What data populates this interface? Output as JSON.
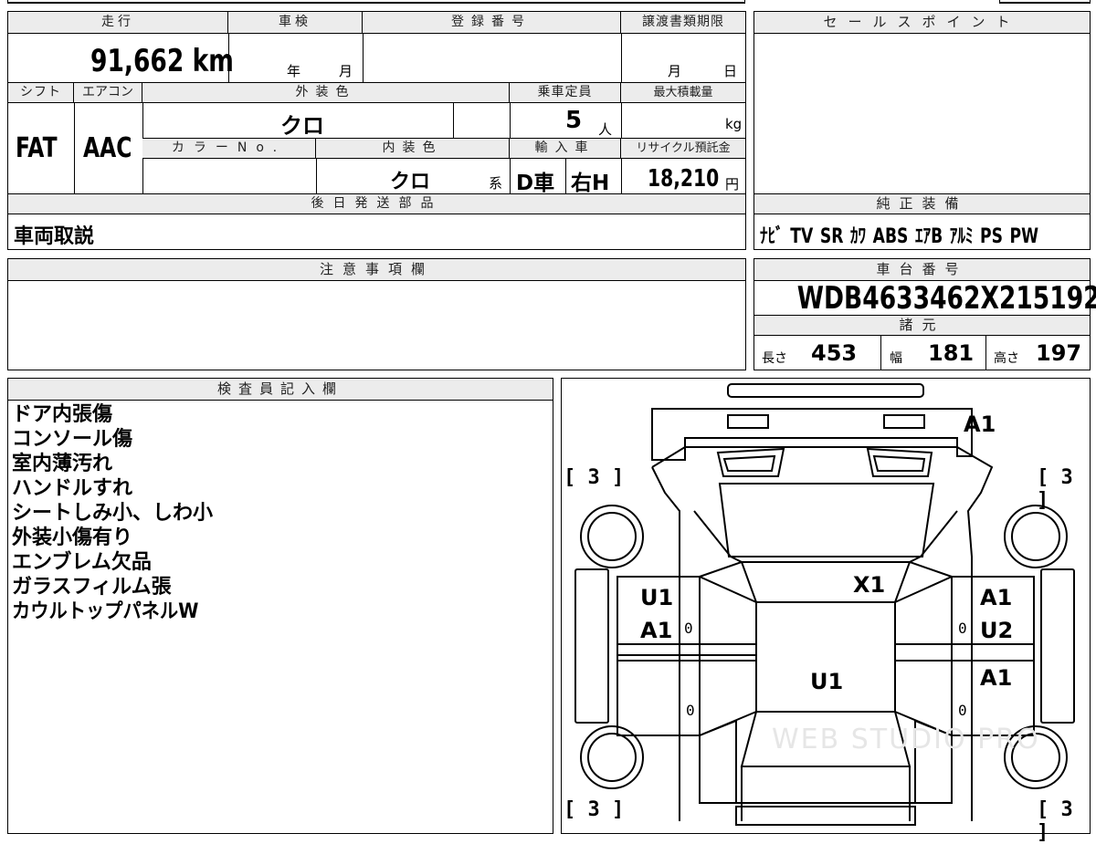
{
  "vehicle": {
    "mileage_label": "走行",
    "mileage_value": "91,662 km",
    "inspection_label": "車検",
    "inspection_year_unit": "年",
    "inspection_month_unit": "月",
    "registration_label": "登録番号",
    "transfer_deadline_label": "譲渡書類期限",
    "transfer_month_unit": "月",
    "transfer_day_unit": "日",
    "shift_label": "シフト",
    "shift_value": "FAT",
    "aircon_label": "エアコン",
    "aircon_value": "AAC",
    "exterior_color_label": "外装色",
    "exterior_color_value": "クロ",
    "capacity_label": "乗車定員",
    "capacity_value": "5",
    "capacity_unit": "人",
    "max_load_label": "最大積載量",
    "max_load_unit": "kg",
    "color_no_label": "カラーNo.",
    "interior_color_label": "内装色",
    "interior_color_value": "クロ",
    "interior_color_suffix": "系",
    "import_label": "輸入車",
    "import_dealer": "D車",
    "steering": "右H",
    "recycle_label": "リサイクル預託金",
    "recycle_value": "18,210",
    "recycle_unit": "円",
    "later_parts_label": "後日発送部品",
    "later_parts_value": "車両取説"
  },
  "sales_point": {
    "label": "セールスポイント"
  },
  "equipment": {
    "label": "純正装備",
    "items": [
      "ﾅﾋﾞ",
      "TV",
      "SR",
      "ｶﾜ",
      "ABS",
      "ｴｱB",
      "ｱﾙﾐ",
      "PS",
      "PW"
    ]
  },
  "caution": {
    "label": "注意事項欄"
  },
  "chassis": {
    "label": "車台番号",
    "value": "WDB4633462X215192",
    "specs_label": "諸元",
    "length_label": "長さ",
    "length_value": "453",
    "width_label": "幅",
    "width_value": "181",
    "height_label": "高さ",
    "height_value": "197"
  },
  "inspector": {
    "label": "検査員記入欄",
    "notes": [
      "ドア内張傷",
      "コンソール傷",
      "室内薄汚れ",
      "ハンドルすれ",
      "シートしみ小、しわ小",
      "外装小傷有り",
      "エンブレム欠品",
      "ガラスフィルム張",
      "カウルトップパネルW"
    ]
  },
  "diagram": {
    "marks": {
      "rear": "A1",
      "roof": "X1",
      "left_front_door": "U1",
      "left_front_door_2": "A1",
      "right_front_door": "A1",
      "right_front_door_2": "U2",
      "center": "U1",
      "right_rear_door": "A1",
      "tire_fl": "3",
      "tire_fr": "3",
      "tire_rl": "3",
      "tire_rr": "3",
      "zero": "0"
    },
    "watermark": "WEB STUDIO PRO"
  }
}
